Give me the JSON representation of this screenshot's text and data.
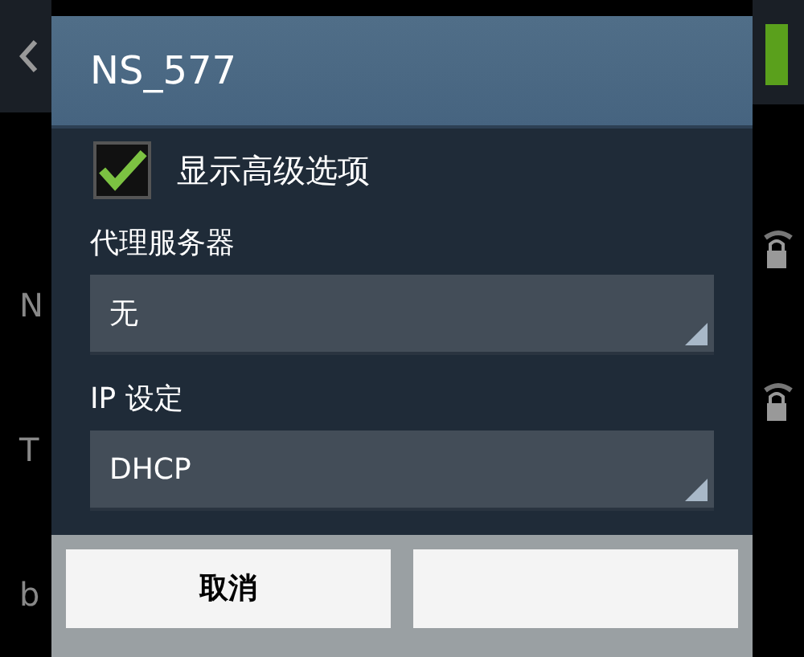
{
  "background": {
    "wifi_switch": {
      "on": true
    },
    "list_letters": [
      "N",
      "T",
      "b"
    ]
  },
  "dialog": {
    "title": "NS_577",
    "advanced": {
      "label": "显示高级选项",
      "checked": true
    },
    "fields": [
      {
        "label": "代理服务器",
        "value": "无"
      },
      {
        "label": "IP 设定",
        "value": "DHCP"
      }
    ],
    "buttons": [
      "取消"
    ]
  }
}
